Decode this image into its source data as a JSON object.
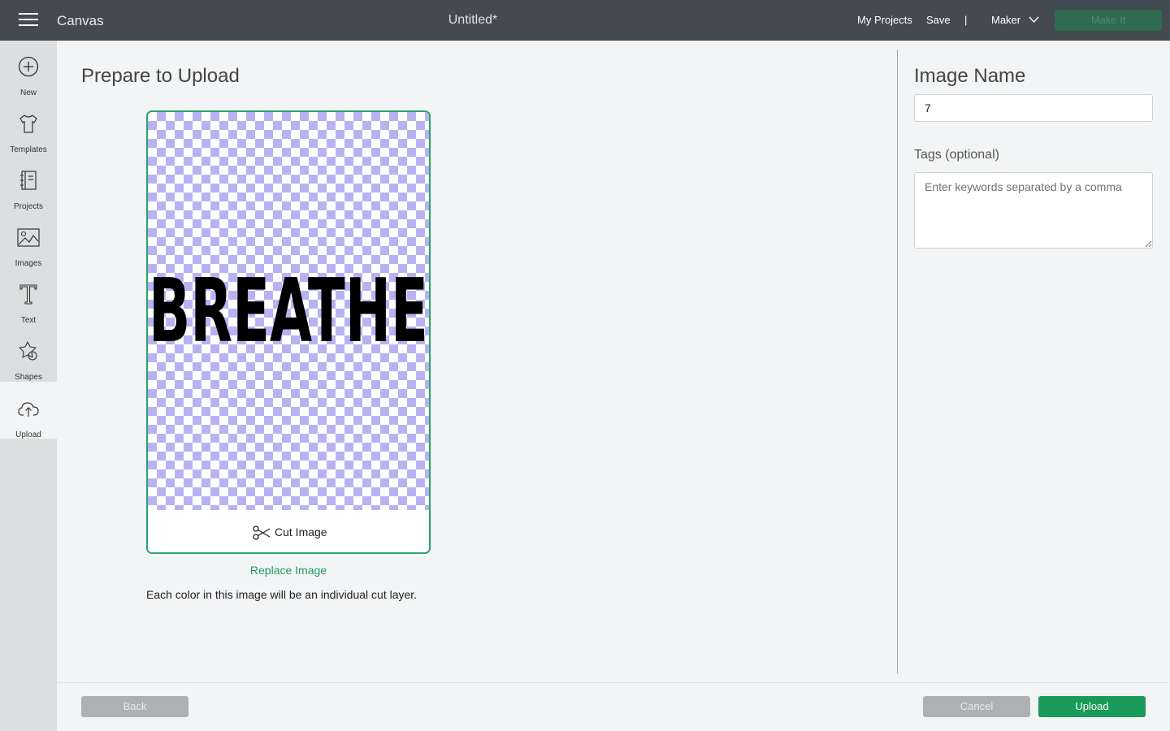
{
  "topbar": {
    "app_title": "Canvas",
    "doc_title": "Untitled*",
    "my_projects": "My Projects",
    "save": "Save",
    "separator": "|",
    "machine": "Maker",
    "make_it": "Make It"
  },
  "sidebar": {
    "items": [
      {
        "label": "New",
        "icon": "plus-circle-icon"
      },
      {
        "label": "Templates",
        "icon": "tshirt-icon"
      },
      {
        "label": "Projects",
        "icon": "notebook-icon"
      },
      {
        "label": "Images",
        "icon": "image-icon"
      },
      {
        "label": "Text",
        "icon": "text-t-icon"
      },
      {
        "label": "Shapes",
        "icon": "shapes-icon"
      },
      {
        "label": "Upload",
        "icon": "cloud-upload-icon",
        "active": true
      }
    ]
  },
  "main": {
    "title": "Prepare to Upload",
    "preview_text": "BREATHE",
    "cut_image": "Cut Image",
    "replace_image": "Replace Image",
    "info": "Each color in this image will be an individual cut layer."
  },
  "form": {
    "image_name_label": "Image Name",
    "image_name_value": "7",
    "tags_label": "Tags (optional)",
    "tags_placeholder": "Enter keywords separated by a comma"
  },
  "footer": {
    "back": "Back",
    "cancel": "Cancel",
    "upload": "Upload"
  },
  "colors": {
    "accent": "#1a9a5a",
    "topbar": "#434a50",
    "checker": "#b9b2f2"
  }
}
